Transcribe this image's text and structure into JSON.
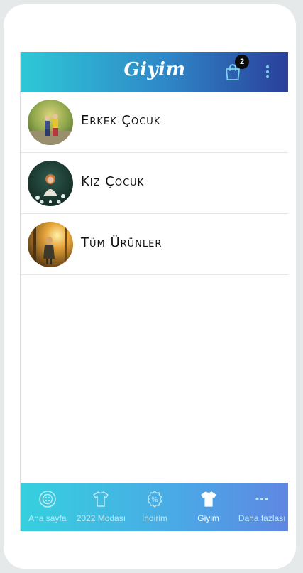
{
  "header": {
    "title": "Giyim",
    "cart_count": "2",
    "cart_icon": "shopping-bag-icon",
    "menu_icon": "more-vertical-icon"
  },
  "categories": [
    {
      "label": "Erkek Çocuk",
      "image": "boys-playing-in-park-photo"
    },
    {
      "label": "Kız Çocuk",
      "image": "girl-in-flower-field-photo"
    },
    {
      "label": "Tüm Ürünler",
      "image": "child-in-sunlit-forest-photo"
    }
  ],
  "bottom_nav": {
    "items": [
      {
        "label": "Ana sayfa",
        "icon": "button-icon",
        "active": false
      },
      {
        "label": "2022 Modası",
        "icon": "tshirt-icon",
        "active": false
      },
      {
        "label": "İndirim",
        "icon": "discount-badge-icon",
        "active": false
      },
      {
        "label": "Giyim",
        "icon": "tshirt-filled-icon",
        "active": true
      },
      {
        "label": "Daha fazlası",
        "icon": "more-horizontal-icon",
        "active": false
      }
    ]
  },
  "colors": {
    "header_gradient": [
      "#2ec8d7",
      "#2f86c7",
      "#2a3f9a"
    ],
    "nav_gradient": [
      "#35d0de",
      "#4ba8e6",
      "#5f86e2"
    ],
    "active_label": "#ffffff",
    "inactive_label": "#bfeaf4"
  }
}
